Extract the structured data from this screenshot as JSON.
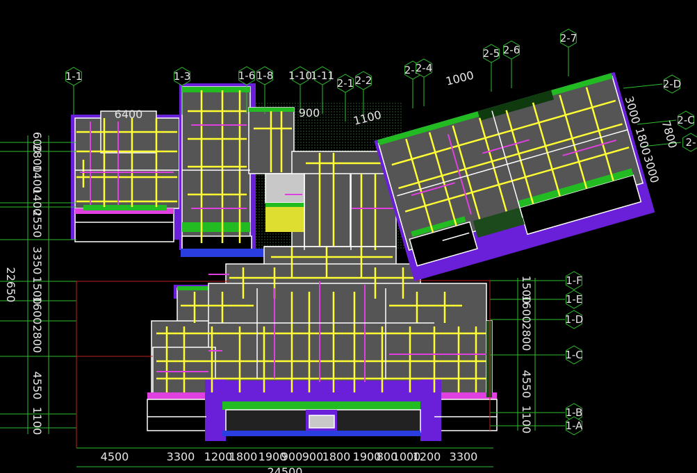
{
  "axis_bubbles": [
    {
      "label": "1-1"
    },
    {
      "label": "1-3"
    },
    {
      "label": "1-6"
    },
    {
      "label": "1-8"
    },
    {
      "label": "1-10"
    },
    {
      "label": "1-11"
    },
    {
      "label": "2-1"
    },
    {
      "label": "2-2"
    },
    {
      "label": "2-3"
    },
    {
      "label": "2-4"
    },
    {
      "label": "2-5"
    },
    {
      "label": "2-6"
    },
    {
      "label": "2-7"
    },
    {
      "label": "2-D"
    },
    {
      "label": "2-C"
    },
    {
      "label": "2-"
    },
    {
      "label": "1-F"
    },
    {
      "label": "1-E"
    },
    {
      "label": "1-D"
    },
    {
      "label": "1-C"
    },
    {
      "label": "1-B"
    },
    {
      "label": "1-A"
    }
  ],
  "dimensions": {
    "left_chain": [
      "600",
      "2800",
      "1400",
      "1400",
      "2550",
      "3350",
      "1500",
      "1600",
      "2800",
      "4550",
      "1100"
    ],
    "left_total": "22650",
    "right_chain": [
      "1500",
      "1600",
      "2800",
      "4550",
      "1100"
    ],
    "bottom_chain": [
      "4500",
      "3300",
      "1200",
      "1800",
      "1900",
      "900",
      "900",
      "1800",
      "1900",
      "800",
      "1000",
      "1200",
      "3300"
    ],
    "bottom_total": "24500",
    "wing_chain": [
      "3000",
      "1800",
      "3000"
    ],
    "wing_total": "7800",
    "top_labels": [
      "6400",
      "900",
      "1100",
      "1000"
    ]
  },
  "colors": {
    "background": "#000000",
    "axis": "#2fbf2f",
    "slab": "#555555",
    "beam": "#ffff33",
    "magenta": "#e040e0",
    "wall": "#6a20d8",
    "edge": "#22bb22",
    "outline": "#ffffff",
    "dim_red": "#d02020"
  }
}
